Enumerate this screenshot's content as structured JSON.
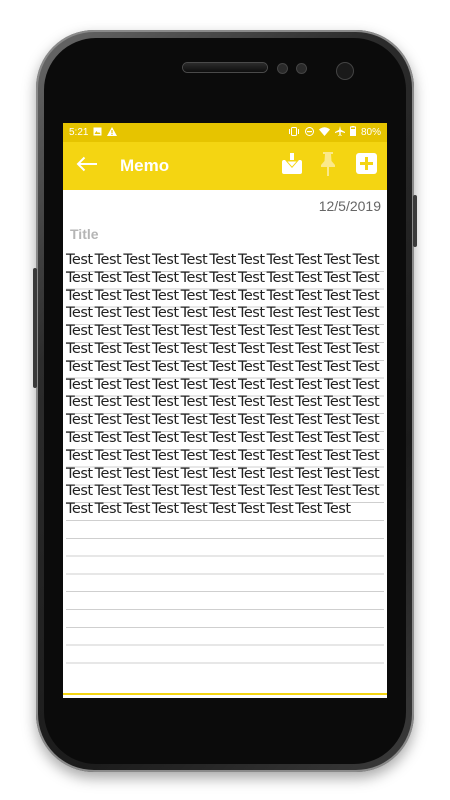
{
  "status_bar": {
    "time": "5:21",
    "battery": "80%",
    "left_icons": [
      "gallery-icon",
      "warning-icon"
    ],
    "right_icons": [
      "vibrate-icon",
      "dnd-icon",
      "wifi-icon",
      "airplane-icon",
      "battery-icon"
    ]
  },
  "toolbar": {
    "title": "Memo",
    "back_icon": "arrow-left-icon",
    "actions": [
      "download-icon",
      "pin-icon",
      "add-icon"
    ]
  },
  "memo": {
    "date": "12/5/2019",
    "title_placeholder": "Title",
    "body": "Test Test Test Test Test Test Test Test Test Test Test Test Test Test Test Test Test Test Test Test Test Test Test Test Test Test Test Test Test Test Test Test Test Test Test Test Test Test Test Test Test Test Test Test Test Test Test Test Test Test Test Test Test Test Test Test Test Test Test Test Test Test Test Test Test Test Test Test Test Test Test Test Test Test Test Test Test Test Test Test Test Test Test Test Test Test Test Test Test Test Test Test Test Test Test Test Test Test Test Test Test Test Test Test Test Test Test Test Test Test Test Test Test Test Test Test Test Test Test Test Test Test Test Test Test Test Test Test Test Test Test Test Test Test Test Test Test Test Test Test Test Test Test Test Test Test Test Test Test Test Test Test Test Test Test Test Test Test Test Test Test Test Test Test"
  },
  "colors": {
    "accent": "#f4d512",
    "status_bar": "#e6c400"
  }
}
